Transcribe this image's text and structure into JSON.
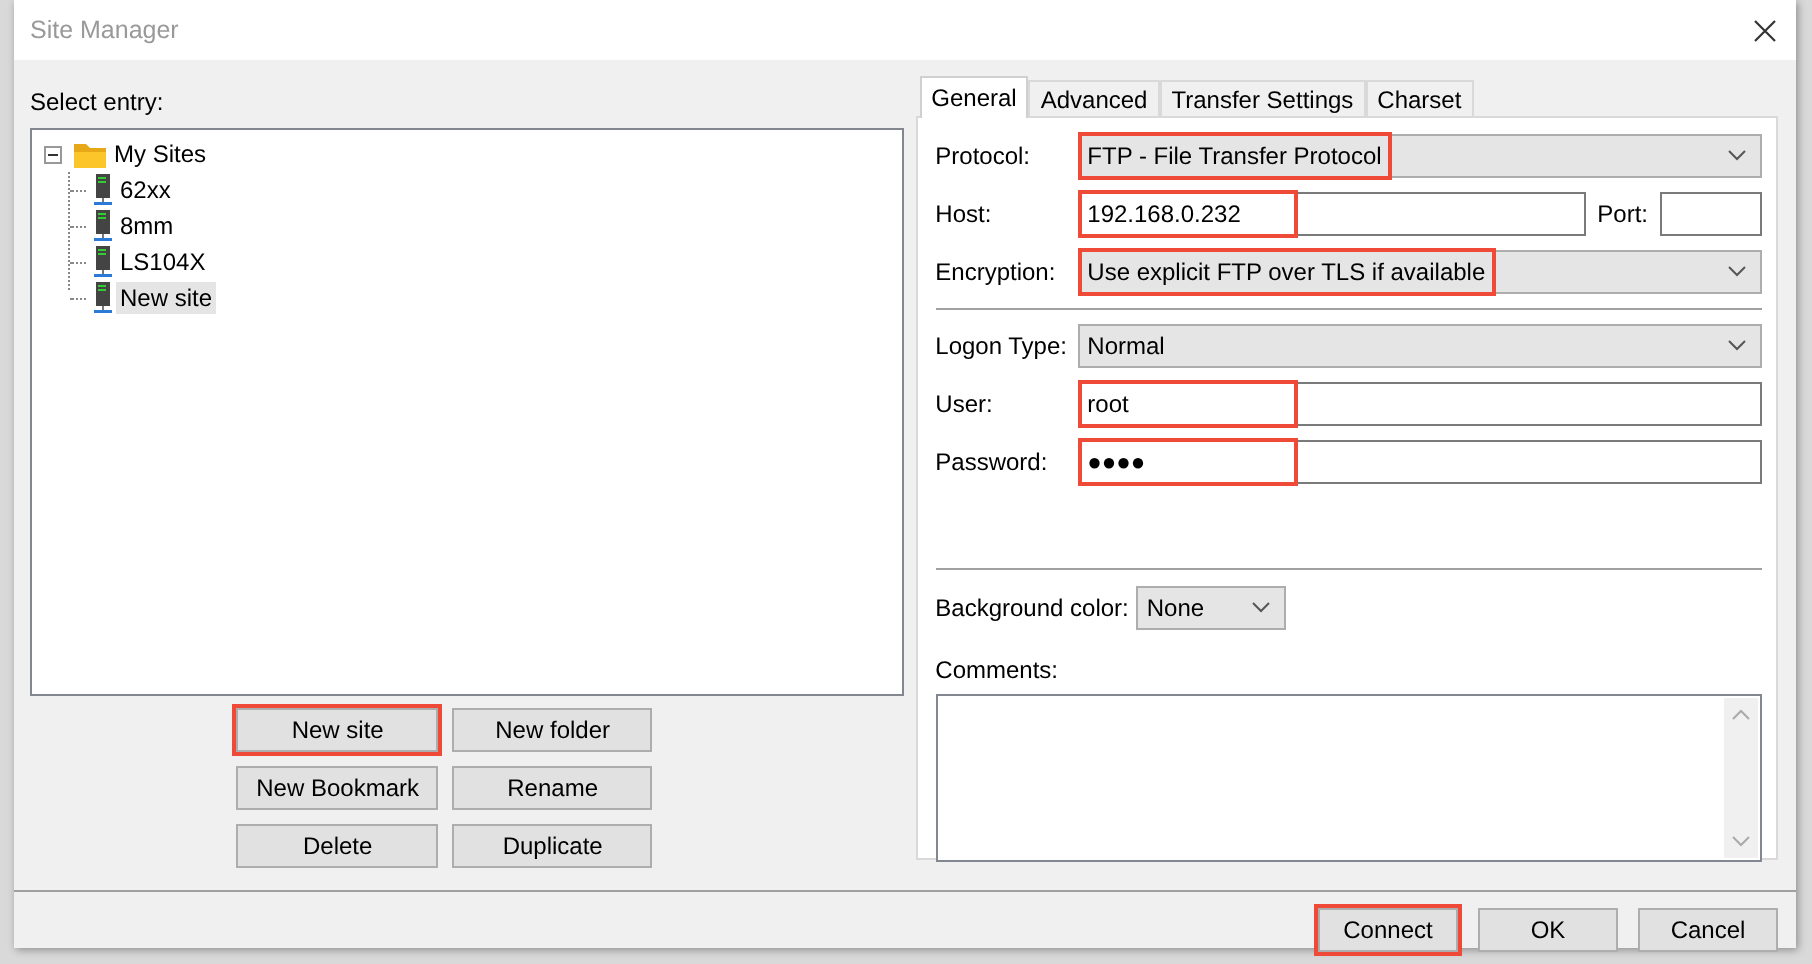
{
  "window": {
    "title": "Site Manager"
  },
  "tree": {
    "label": "Select entry:",
    "root": {
      "label": "My Sites",
      "expanded": true,
      "children": [
        {
          "label": "62xx",
          "selected": false
        },
        {
          "label": "8mm",
          "selected": false
        },
        {
          "label": "LS104X",
          "selected": false
        },
        {
          "label": "New site",
          "selected": true
        }
      ]
    }
  },
  "site_buttons": [
    {
      "label": "New site",
      "highlighted": true
    },
    {
      "label": "New folder",
      "highlighted": false
    },
    {
      "label": "New Bookmark",
      "highlighted": false
    },
    {
      "label": "Rename",
      "highlighted": false
    },
    {
      "label": "Delete",
      "highlighted": false
    },
    {
      "label": "Duplicate",
      "highlighted": false
    }
  ],
  "tabs": [
    {
      "label": "General",
      "selected": true
    },
    {
      "label": "Advanced",
      "selected": false
    },
    {
      "label": "Transfer Settings",
      "selected": false
    },
    {
      "label": "Charset",
      "selected": false
    }
  ],
  "server_fields": [
    {
      "kind": "dropdown",
      "label": "Protocol:",
      "value": "FTP - File Transfer Protocol",
      "highlighted": true
    },
    {
      "kind": "host",
      "label": "Host:",
      "value": "192.168.0.232",
      "highlighted": true,
      "port_label": "Port:"
    },
    {
      "kind": "dropdown",
      "label": "Encryption:",
      "value": "Use explicit FTP over TLS if available",
      "highlighted": true
    }
  ],
  "logon_fields": [
    {
      "kind": "dropdown",
      "label": "Logon Type:",
      "value": "Normal",
      "highlighted": false
    },
    {
      "kind": "text",
      "label": "User:",
      "value": "root",
      "highlighted": true
    },
    {
      "kind": "text",
      "label": "Password:",
      "value": "●●●●",
      "highlighted": true
    }
  ],
  "background_color": {
    "label": "Background color:",
    "value": "None"
  },
  "comments": {
    "label": "Comments:"
  },
  "dialog_buttons": [
    {
      "label": "Connect",
      "highlighted": true
    },
    {
      "label": "OK",
      "highlighted": false
    },
    {
      "label": "Cancel",
      "highlighted": false
    }
  ]
}
